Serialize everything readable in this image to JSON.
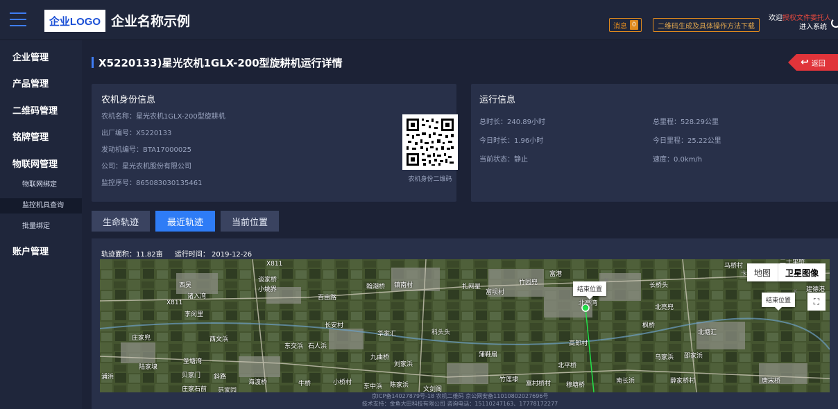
{
  "header": {
    "logo": "企业LOGO",
    "company_name": "企业名称示例",
    "messages_label": "消息",
    "messages_count": "0",
    "qr_download_label": "二维码生成及具体操作方法下载",
    "welcome_prefix": "欢迎",
    "welcome_name": "授权文件委托人",
    "enter_system": "进入系统"
  },
  "sidebar": {
    "items": [
      {
        "label": "企业管理"
      },
      {
        "label": "产品管理"
      },
      {
        "label": "二维码管理"
      },
      {
        "label": "铭牌管理"
      },
      {
        "label": "物联网管理"
      },
      {
        "label": "物联网绑定"
      },
      {
        "label": "监控机具查询"
      },
      {
        "label": "批量绑定"
      },
      {
        "label": "账户管理"
      }
    ]
  },
  "page": {
    "title": "X5220133)星光农机1GLX-200型旋耕机运行详情",
    "back_label": "返回"
  },
  "identity": {
    "title": "农机身份信息",
    "lines": [
      "农机名称：星光农机1GLX-200型旋耕机",
      "出厂编号：X5220133",
      "发动机编号：BTA17000025",
      "公司：星光农机股份有限公司",
      "监控序号：865083030135461"
    ],
    "qr_caption": "农机身份二维码"
  },
  "operation": {
    "title": "运行信息",
    "total_duration": "总时长：240.89小时",
    "today_duration": "今日时长：1.96小时",
    "current_status": "当前状态：静止",
    "total_mileage": "总里程：528.29公里",
    "today_mileage": "今日里程：25.22公里",
    "speed": "速度：0.0km/h"
  },
  "tabs": [
    {
      "label": "生命轨迹"
    },
    {
      "label": "最近轨迹",
      "active": true
    },
    {
      "label": "当前位置"
    }
  ],
  "map": {
    "track_area": "轨迹面积：11.82亩",
    "run_time": "运行时间： 2019-12-26",
    "type_map": "地图",
    "type_satellite": "卫星图像",
    "end_tip": "结束位置",
    "places": [
      "X811",
      "谈家桥",
      "西吴",
      "小姚界",
      "翰潮桥",
      "镇南村",
      "扎网星",
      "富坝村",
      "竹园兜",
      "富港",
      "马桥村",
      "卞家村",
      "二十里桥",
      "诸入湾",
      "百亩路",
      "长桥头",
      "建德港",
      "X811",
      "李闵里",
      "长安村",
      "北亭湾",
      "北亮兜",
      "枫桥",
      "北塘汇",
      "庄家兜",
      "西文浜",
      "东交浜",
      "石人浜",
      "华家汇",
      "科头头",
      "高郎村",
      "乌家浜",
      "邵家浜",
      "陆家埭",
      "圣塘湾",
      "九曲桥",
      "刘家浜",
      "蒲鞋扇",
      "北平桥",
      "贝家门",
      "斜路",
      "海渡桥",
      "牛桥",
      "小桥村",
      "东中浜",
      "陈家浜",
      "文剑阁",
      "竹莲埭",
      "富村桥村",
      "穆塘桥",
      "南长浜",
      "薛家桥村",
      "唐宋桥",
      "庄家石前",
      "范家园",
      "浦浜"
    ]
  },
  "footer": {
    "line1": "京ICP备14027879号-18 农机二维码 京公网安备11010802027696号",
    "line2": "技术支持：金鱼大田科技有限公司     咨询电话：15110247163、17778172277"
  }
}
